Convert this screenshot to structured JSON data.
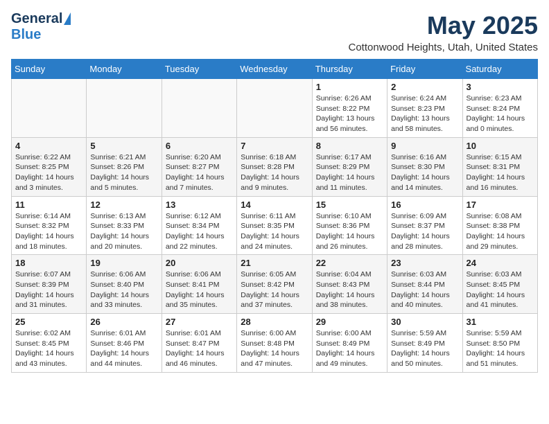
{
  "header": {
    "logo_general": "General",
    "logo_blue": "Blue",
    "month_title": "May 2025",
    "location": "Cottonwood Heights, Utah, United States"
  },
  "days_of_week": [
    "Sunday",
    "Monday",
    "Tuesday",
    "Wednesday",
    "Thursday",
    "Friday",
    "Saturday"
  ],
  "weeks": [
    [
      {
        "day": "",
        "text": ""
      },
      {
        "day": "",
        "text": ""
      },
      {
        "day": "",
        "text": ""
      },
      {
        "day": "",
        "text": ""
      },
      {
        "day": "1",
        "text": "Sunrise: 6:26 AM\nSunset: 8:22 PM\nDaylight: 13 hours and 56 minutes."
      },
      {
        "day": "2",
        "text": "Sunrise: 6:24 AM\nSunset: 8:23 PM\nDaylight: 13 hours and 58 minutes."
      },
      {
        "day": "3",
        "text": "Sunrise: 6:23 AM\nSunset: 8:24 PM\nDaylight: 14 hours and 0 minutes."
      }
    ],
    [
      {
        "day": "4",
        "text": "Sunrise: 6:22 AM\nSunset: 8:25 PM\nDaylight: 14 hours and 3 minutes."
      },
      {
        "day": "5",
        "text": "Sunrise: 6:21 AM\nSunset: 8:26 PM\nDaylight: 14 hours and 5 minutes."
      },
      {
        "day": "6",
        "text": "Sunrise: 6:20 AM\nSunset: 8:27 PM\nDaylight: 14 hours and 7 minutes."
      },
      {
        "day": "7",
        "text": "Sunrise: 6:18 AM\nSunset: 8:28 PM\nDaylight: 14 hours and 9 minutes."
      },
      {
        "day": "8",
        "text": "Sunrise: 6:17 AM\nSunset: 8:29 PM\nDaylight: 14 hours and 11 minutes."
      },
      {
        "day": "9",
        "text": "Sunrise: 6:16 AM\nSunset: 8:30 PM\nDaylight: 14 hours and 14 minutes."
      },
      {
        "day": "10",
        "text": "Sunrise: 6:15 AM\nSunset: 8:31 PM\nDaylight: 14 hours and 16 minutes."
      }
    ],
    [
      {
        "day": "11",
        "text": "Sunrise: 6:14 AM\nSunset: 8:32 PM\nDaylight: 14 hours and 18 minutes."
      },
      {
        "day": "12",
        "text": "Sunrise: 6:13 AM\nSunset: 8:33 PM\nDaylight: 14 hours and 20 minutes."
      },
      {
        "day": "13",
        "text": "Sunrise: 6:12 AM\nSunset: 8:34 PM\nDaylight: 14 hours and 22 minutes."
      },
      {
        "day": "14",
        "text": "Sunrise: 6:11 AM\nSunset: 8:35 PM\nDaylight: 14 hours and 24 minutes."
      },
      {
        "day": "15",
        "text": "Sunrise: 6:10 AM\nSunset: 8:36 PM\nDaylight: 14 hours and 26 minutes."
      },
      {
        "day": "16",
        "text": "Sunrise: 6:09 AM\nSunset: 8:37 PM\nDaylight: 14 hours and 28 minutes."
      },
      {
        "day": "17",
        "text": "Sunrise: 6:08 AM\nSunset: 8:38 PM\nDaylight: 14 hours and 29 minutes."
      }
    ],
    [
      {
        "day": "18",
        "text": "Sunrise: 6:07 AM\nSunset: 8:39 PM\nDaylight: 14 hours and 31 minutes."
      },
      {
        "day": "19",
        "text": "Sunrise: 6:06 AM\nSunset: 8:40 PM\nDaylight: 14 hours and 33 minutes."
      },
      {
        "day": "20",
        "text": "Sunrise: 6:06 AM\nSunset: 8:41 PM\nDaylight: 14 hours and 35 minutes."
      },
      {
        "day": "21",
        "text": "Sunrise: 6:05 AM\nSunset: 8:42 PM\nDaylight: 14 hours and 37 minutes."
      },
      {
        "day": "22",
        "text": "Sunrise: 6:04 AM\nSunset: 8:43 PM\nDaylight: 14 hours and 38 minutes."
      },
      {
        "day": "23",
        "text": "Sunrise: 6:03 AM\nSunset: 8:44 PM\nDaylight: 14 hours and 40 minutes."
      },
      {
        "day": "24",
        "text": "Sunrise: 6:03 AM\nSunset: 8:45 PM\nDaylight: 14 hours and 41 minutes."
      }
    ],
    [
      {
        "day": "25",
        "text": "Sunrise: 6:02 AM\nSunset: 8:45 PM\nDaylight: 14 hours and 43 minutes."
      },
      {
        "day": "26",
        "text": "Sunrise: 6:01 AM\nSunset: 8:46 PM\nDaylight: 14 hours and 44 minutes."
      },
      {
        "day": "27",
        "text": "Sunrise: 6:01 AM\nSunset: 8:47 PM\nDaylight: 14 hours and 46 minutes."
      },
      {
        "day": "28",
        "text": "Sunrise: 6:00 AM\nSunset: 8:48 PM\nDaylight: 14 hours and 47 minutes."
      },
      {
        "day": "29",
        "text": "Sunrise: 6:00 AM\nSunset: 8:49 PM\nDaylight: 14 hours and 49 minutes."
      },
      {
        "day": "30",
        "text": "Sunrise: 5:59 AM\nSunset: 8:49 PM\nDaylight: 14 hours and 50 minutes."
      },
      {
        "day": "31",
        "text": "Sunrise: 5:59 AM\nSunset: 8:50 PM\nDaylight: 14 hours and 51 minutes."
      }
    ]
  ]
}
